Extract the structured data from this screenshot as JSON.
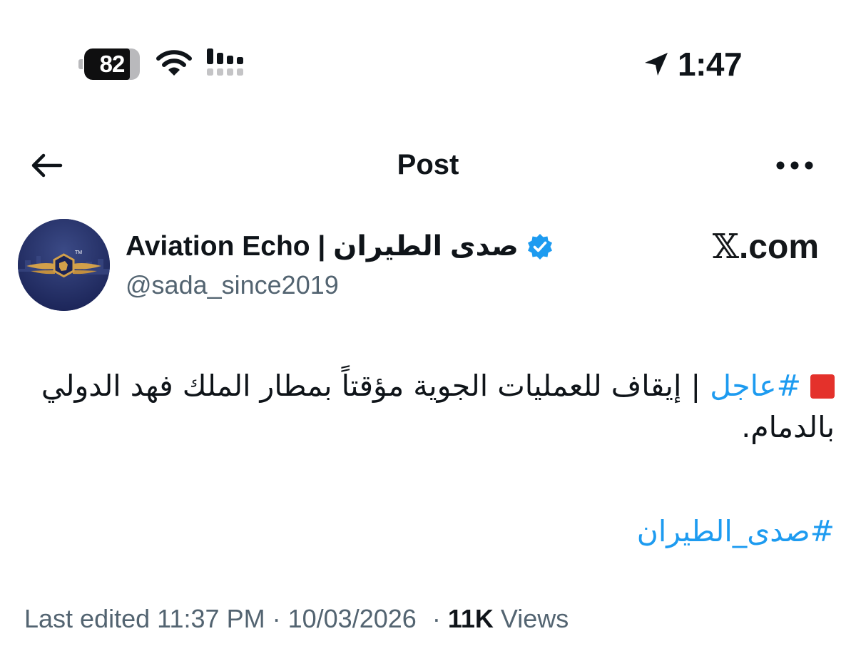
{
  "status_bar": {
    "battery_percent": "82",
    "battery_level": 0.82,
    "time": "1:47",
    "icons": [
      "battery-icon",
      "wifi-icon",
      "cellular-signal-icon",
      "location-arrow-icon"
    ]
  },
  "header": {
    "title": "Post",
    "back_icon": "arrow-left-icon",
    "more_icon": "more-horizontal-icon"
  },
  "author": {
    "display_name": "Aviation Echo | صدى الطيران",
    "handle": "@sada_since2019",
    "verified": true,
    "badge_color": "#1d9bf0",
    "avatar_label": "TM"
  },
  "watermark": {
    "x_glyph": "𝕏",
    "domain": ".com"
  },
  "post": {
    "emoji_icon": "red-square-icon",
    "hashtag_1": "#عاجل",
    "separator": " | ",
    "body": "إيقاف للعمليات الجوية مؤقتاً بمطار الملك فهد الدولي بالدمام.",
    "hashtag_2": "#صدى_الطيران"
  },
  "meta": {
    "edited_label": "Last edited",
    "time": "11:37 PM",
    "dot": "·",
    "date": "10/03/2026",
    "views_count": "11K",
    "views_label": "Views"
  },
  "colors": {
    "text_primary": "#0f1419",
    "text_secondary": "#536471",
    "link": "#1d9bf0",
    "alert_red": "#e4312b",
    "avatar_bg": "#1f2a60",
    "avatar_gold": "#d2a04a"
  }
}
